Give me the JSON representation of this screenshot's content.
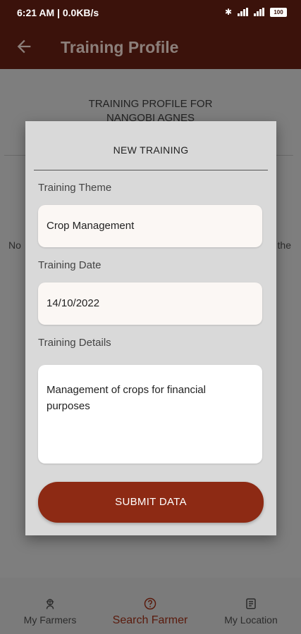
{
  "status_bar": {
    "time": "6:21 AM | 0.0KB/s",
    "battery": "100"
  },
  "app_bar": {
    "title": "Training Profile"
  },
  "background": {
    "heading_line1": "TRAINING PROFILE FOR",
    "heading_line2": "NANGOBI AGNES",
    "left_fragment": "No",
    "right_fragment": "the"
  },
  "dialog": {
    "title": "NEW TRAINING",
    "theme_label": "Training Theme",
    "theme_value": "Crop Management",
    "date_label": "Training Date",
    "date_value": "14/10/2022",
    "details_label": "Training Details",
    "details_value": "Management of crops for financial purposes",
    "submit_label": "SUBMIT DATA"
  },
  "bottom_nav": {
    "items": [
      {
        "label": "My Farmers",
        "icon": "farmer-icon"
      },
      {
        "label": "Search Farmer",
        "icon": "question-icon",
        "active": true
      },
      {
        "label": "My Location",
        "icon": "location-icon"
      }
    ]
  },
  "colors": {
    "app_bar": "#3b120b",
    "accent": "#8d2a14",
    "dialog_bg": "#d9d9d9"
  }
}
